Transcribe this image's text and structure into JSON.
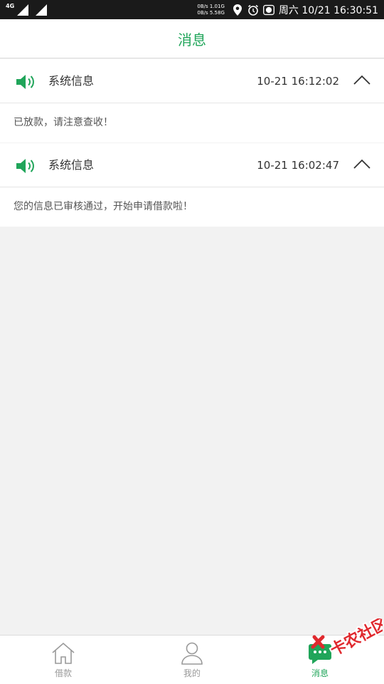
{
  "status_bar": {
    "network_label": "4G",
    "speed_up": "0B/s 1.01G",
    "speed_down": "0B/s 5.58G",
    "battery_level": "85",
    "datetime": "周六 10/21 16:30:51"
  },
  "header": {
    "title": "消息"
  },
  "messages": [
    {
      "title": "系统信息",
      "time": "10-21 16:12:02",
      "body": "已放款，请注意查收！"
    },
    {
      "title": "系统信息",
      "time": "10-21 16:02:47",
      "body": "您的信息已审核通过，开始申请借款啦！"
    }
  ],
  "nav": {
    "items": [
      {
        "label": "借款",
        "icon": "home-icon",
        "active": false
      },
      {
        "label": "我的",
        "icon": "user-icon",
        "active": false
      },
      {
        "label": "消息",
        "icon": "message-icon",
        "active": true
      }
    ]
  },
  "watermark": {
    "text": "卡农社区"
  },
  "colors": {
    "accent": "#20a55a",
    "watermark_red": "#e0292e"
  }
}
